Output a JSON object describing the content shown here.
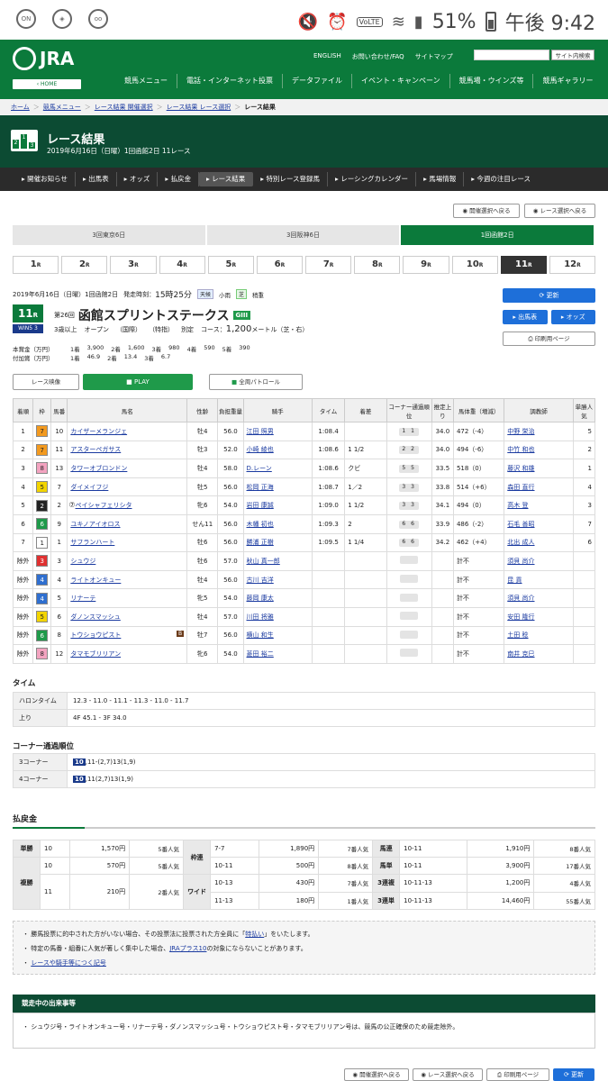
{
  "status": {
    "battery": "51%",
    "time": "午後 9:42",
    "volte": "VoLTE",
    "icons": [
      "wifi-calling-icon",
      "shield-icon",
      "voicemail-icon"
    ]
  },
  "header": {
    "logo": "JRA",
    "home": "HOME",
    "links": [
      "ENGLISH",
      "お問い合わせ/FAQ",
      "サイトマップ"
    ],
    "search_btn": "サイト内検索",
    "menu": [
      "競馬メニュー",
      "電話・インターネット投票",
      "データファイル",
      "イベント・キャンペーン",
      "競馬場・ウインズ等",
      "競馬ギャラリー"
    ]
  },
  "breadcrumb": [
    "ホーム",
    "競馬メニュー",
    "レース結果 開催選択",
    "レース結果 レース選択",
    "レース結果"
  ],
  "title": {
    "main": "レース結果",
    "sub": "2019年6月16日（日曜）1回函館2日 11レース",
    "icon_digits": [
      "2",
      "1",
      "3"
    ]
  },
  "subnav": [
    "開催お知らせ",
    "出馬表",
    "オッズ",
    "払戻金",
    "レース結果",
    "特別レース登録馬",
    "レーシングカレンダー",
    "馬場情報",
    "今週の注目レース"
  ],
  "select_buttons": {
    "prev": "開催選択へ戻る",
    "race": "レース選択へ戻る"
  },
  "venues": [
    "3回東京6日",
    "3回阪神6日",
    "1回函館2日"
  ],
  "races": [
    "1",
    "2",
    "3",
    "4",
    "5",
    "6",
    "7",
    "8",
    "9",
    "10",
    "11",
    "12"
  ],
  "race_suffix": "R",
  "race": {
    "date": "2019年6月16日（日曜）1回函館2日",
    "post_label": "発走時刻：",
    "post_time": "15時25分",
    "weather_label": "天候",
    "weather": "小雨",
    "track_label": "芝",
    "going": "稍重",
    "num": "11",
    "num_suffix": "R",
    "edition": "第26回",
    "name": "函館スプリントステークス",
    "grade": "GIII",
    "win5": "WIN5",
    "win5_num": "3",
    "cond1": "3歳以上",
    "cond2": "オープン",
    "cond3": "（国際）",
    "cond4": "（特指）",
    "cond5": "別定",
    "course_label": "コース：",
    "distance": "1,200",
    "dist_unit": "メートル（芝・右）",
    "prize_label": "本賞金（万円）",
    "prize": [
      "1着",
      "3,900",
      "2着",
      "1,600",
      "3着",
      "980",
      "4着",
      "590",
      "5着",
      "390"
    ],
    "bonus_label": "付加賞（万円）",
    "bonus": [
      "1着",
      "46.9",
      "2着",
      "13.4",
      "3着",
      "6.7"
    ]
  },
  "right_buttons": {
    "update": "更新",
    "card": "出馬表",
    "odds": "オッズ",
    "print": "印刷用ページ"
  },
  "media": {
    "video": "レース映像",
    "play": "PLAY",
    "patrol": "全周パトロール"
  },
  "table_headers": [
    "着順",
    "枠",
    "馬番",
    "馬名",
    "性齢",
    "負担重量",
    "騎手",
    "タイム",
    "着差",
    "コーナー通過順位",
    "推定上り",
    "馬体重（増減）",
    "調教師",
    "単勝人気"
  ],
  "results": [
    {
      "pos": "1",
      "frame": "7",
      "num": "10",
      "name": "カイザーメランジェ",
      "sex": "牡4",
      "wt": "56.0",
      "jockey": "江田 照男",
      "time": "1:08.4",
      "margin": "",
      "corner": "1 1",
      "last": "34.0",
      "bw": "472（-4）",
      "trainer": "中野 栄治",
      "pop": "5"
    },
    {
      "pos": "2",
      "frame": "7",
      "num": "11",
      "name": "アスターペガサス",
      "sex": "牡3",
      "wt": "52.0",
      "jockey": "小崎 綾也",
      "time": "1:08.6",
      "margin": "1 1/2",
      "corner": "2 2",
      "last": "34.0",
      "bw": "494（-6）",
      "trainer": "中竹 和也",
      "pop": "2"
    },
    {
      "pos": "3",
      "frame": "8",
      "num": "13",
      "name": "タワーオブロンドン",
      "sex": "牡4",
      "wt": "58.0",
      "jockey": "D.レーン",
      "time": "1:08.6",
      "margin": "クビ",
      "corner": "5 5",
      "last": "33.5",
      "bw": "518（0）",
      "trainer": "藤沢 和雄",
      "pop": "1"
    },
    {
      "pos": "4",
      "frame": "5",
      "num": "7",
      "name": "ダイメイフジ",
      "sex": "牡5",
      "wt": "56.0",
      "jockey": "松岡 正海",
      "time": "1:08.7",
      "margin": "1／2",
      "corner": "3 3",
      "last": "33.8",
      "bw": "514（+6）",
      "trainer": "森田 直行",
      "pop": "4"
    },
    {
      "pos": "5",
      "frame": "2",
      "num": "2",
      "name": "ペイシャフェリシタ",
      "sex": "牝6",
      "wt": "54.0",
      "jockey": "岩田 康誠",
      "time": "1:09.0",
      "margin": "1 1/2",
      "corner": "3 3",
      "last": "34.1",
      "bw": "494（0）",
      "trainer": "高木 登",
      "pop": "3"
    },
    {
      "pos": "6",
      "frame": "6",
      "num": "9",
      "name": "ユキノアイオロス",
      "sex": "せん11",
      "wt": "56.0",
      "jockey": "木幡 初也",
      "time": "1:09.3",
      "margin": "2",
      "corner": "6 6",
      "last": "33.9",
      "bw": "486（-2）",
      "trainer": "石毛 善昭",
      "pop": "7"
    },
    {
      "pos": "7",
      "frame": "1",
      "num": "1",
      "name": "サフランハート",
      "sex": "牡6",
      "wt": "56.0",
      "jockey": "勝浦 正樹",
      "time": "1:09.5",
      "margin": "1 1/4",
      "corner": "6 6",
      "last": "34.2",
      "bw": "462（+4）",
      "trainer": "北出 成人",
      "pop": "6"
    },
    {
      "pos": "除外",
      "frame": "3",
      "num": "3",
      "name": "シュウジ",
      "sex": "牡6",
      "wt": "57.0",
      "jockey": "秋山 真一郎",
      "time": "",
      "margin": "",
      "corner": "",
      "last": "",
      "bw": "計不",
      "trainer": "須貝 尚介",
      "pop": ""
    },
    {
      "pos": "除外",
      "frame": "4",
      "num": "4",
      "name": "ライトオンキュー",
      "sex": "牡4",
      "wt": "56.0",
      "jockey": "古川 吉洋",
      "time": "",
      "margin": "",
      "corner": "",
      "last": "",
      "bw": "計不",
      "trainer": "昆 貢",
      "pop": ""
    },
    {
      "pos": "除外",
      "frame": "4",
      "num": "5",
      "name": "リナーテ",
      "sex": "牝5",
      "wt": "54.0",
      "jockey": "藤岡 康太",
      "time": "",
      "margin": "",
      "corner": "",
      "last": "",
      "bw": "計不",
      "trainer": "須貝 尚介",
      "pop": ""
    },
    {
      "pos": "除外",
      "frame": "5",
      "num": "6",
      "name": "ダノンスマッシュ",
      "sex": "牡4",
      "wt": "57.0",
      "jockey": "川田 将雅",
      "time": "",
      "margin": "",
      "corner": "",
      "last": "",
      "bw": "計不",
      "trainer": "安田 隆行",
      "pop": ""
    },
    {
      "pos": "除外",
      "frame": "6",
      "num": "8",
      "name": "トウショウピスト",
      "sex": "牡7",
      "wt": "56.0",
      "jockey": "横山 和生",
      "time": "",
      "margin": "",
      "corner": "",
      "last": "",
      "bw": "計不",
      "trainer": "土田 稔",
      "pop": ""
    },
    {
      "pos": "除外",
      "frame": "8",
      "num": "12",
      "name": "タマモブリリアン",
      "sex": "牝6",
      "wt": "54.0",
      "jockey": "菱田 裕二",
      "time": "",
      "margin": "",
      "corner": "",
      "last": "",
      "bw": "計不",
      "trainer": "南井 克巳",
      "pop": ""
    }
  ],
  "blinker": "B",
  "frame_colors": {
    "1": "#ffffff",
    "2": "#222222",
    "3": "#e03030",
    "4": "#2f6fd0",
    "5": "#f2d400",
    "6": "#1f9a4a",
    "7": "#f39a1f",
    "8": "#f3a3c0"
  },
  "time_section": {
    "title": "タイム",
    "rows": [
      {
        "label": "ハロンタイム",
        "value": "12.3 - 11.0 - 11.1 - 11.3 - 11.0 - 11.7"
      },
      {
        "label": "上り",
        "value": "4F 45.1 - 3F 34.0"
      }
    ]
  },
  "corner_section": {
    "title": "コーナー通過順位",
    "rows": [
      {
        "label": "3コーナー",
        "lead": "10",
        "value": ",11-(2,7)13(1,9)"
      },
      {
        "label": "4コーナー",
        "lead": "10",
        "value": ",11(2,7)13(1,9)"
      }
    ]
  },
  "payout": {
    "title": "払戻金",
    "rows": [
      [
        "単勝",
        "10",
        "1,570円",
        "5番人気",
        "枠連",
        "7-7",
        "1,890円",
        "7番人気",
        "馬連",
        "10-11",
        "1,910円",
        "8番人気"
      ],
      [
        "複勝",
        "10",
        "570円",
        "5番人気",
        "",
        "10-11",
        "500円",
        "8番人気",
        "馬単",
        "10-11",
        "3,900円",
        "17番人気"
      ],
      [
        "",
        "11",
        "210円",
        "2番人気",
        "ワイド",
        "10-13",
        "430円",
        "7番人気",
        "3連複",
        "10-11-13",
        "1,200円",
        "4番人気"
      ],
      [
        "",
        "",
        "",
        "",
        "",
        "11-13",
        "180円",
        "1番人気",
        "3連単",
        "10-11-13",
        "14,460円",
        "55番人気"
      ]
    ]
  },
  "notes": {
    "line1_a": "・ 勝馬投票に的中された方がいない場合、その投票法に投票された方全員に「",
    "line1_link": "特払い",
    "line1_b": "」をいたします。",
    "line2_a": "・ 特定の馬番・組番に人気が著しく集中した場合、",
    "line2_link": "JRAプラス10",
    "line2_b": "の対象にならないことがあります。",
    "line3": "レースや騎手等につく記号"
  },
  "incident": {
    "title": "競走中の出来事等",
    "text": "・ シュウジ号・ライトオンキュー号・リナーテ号・ダノンスマッシュ号・トウショウピスト号・タマモブリリアン号は、競馬の公正確保のため競走除外。"
  },
  "bottom_buttons": [
    "開催選択へ戻る",
    "レース選択へ戻る",
    "印刷用ページ",
    "更新"
  ]
}
